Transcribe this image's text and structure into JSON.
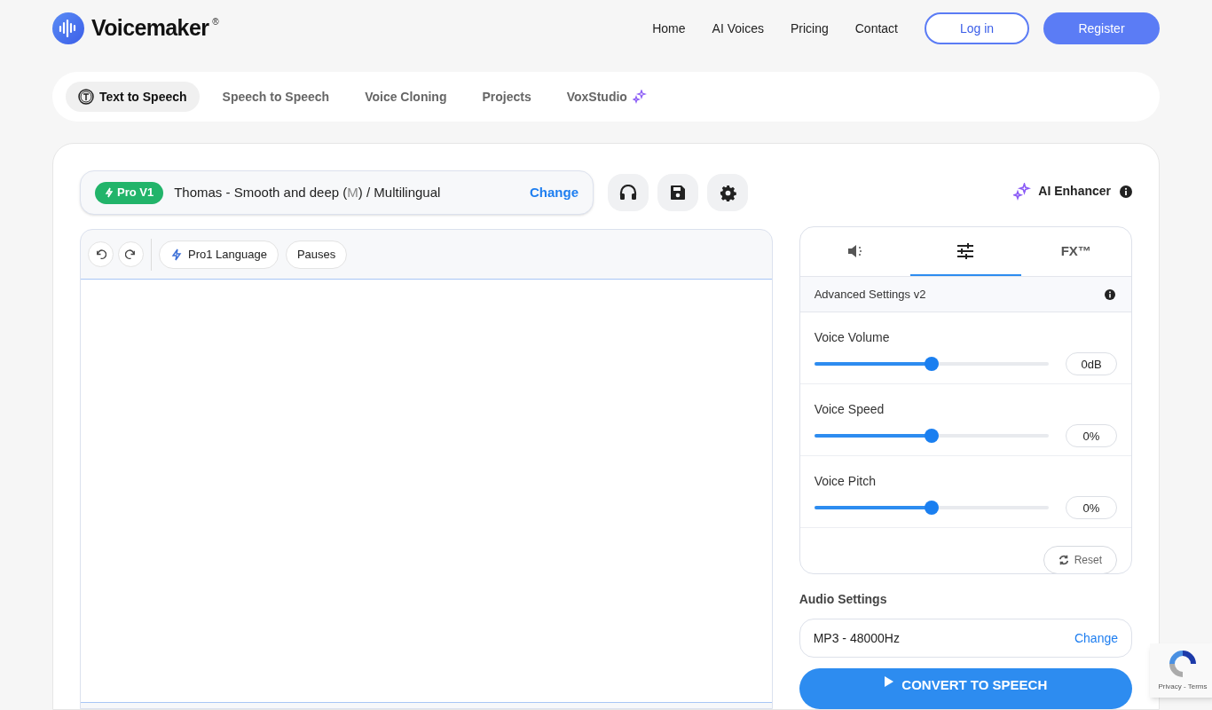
{
  "header": {
    "brand": "Voicemaker",
    "brand_mark": "®",
    "nav": [
      "Home",
      "AI Voices",
      "Pricing",
      "Contact"
    ],
    "login": "Log in",
    "register": "Register"
  },
  "tabs": [
    {
      "label": "Text to Speech",
      "selected": true
    },
    {
      "label": "Speech to Speech",
      "selected": false
    },
    {
      "label": "Voice Cloning",
      "selected": false
    },
    {
      "label": "Projects",
      "selected": false
    },
    {
      "label": "VoxStudio",
      "selected": false
    }
  ],
  "voice": {
    "badge": "Pro V1",
    "name": "Thomas - Smooth and deep (",
    "gender": "M",
    "rest": ") / Multilingual",
    "change": "Change"
  },
  "ai_enhancer": "AI Enhancer",
  "editor": {
    "chips": [
      {
        "label": "Pro1 Language"
      },
      {
        "label": "Pauses"
      }
    ]
  },
  "panel": {
    "tabs": [
      {
        "kind": "icon",
        "selected": false
      },
      {
        "kind": "icon",
        "selected": true
      },
      {
        "kind": "text",
        "label": "FX™",
        "selected": false
      }
    ],
    "header": "Advanced Settings v2",
    "sliders": [
      {
        "label": "Voice Volume",
        "level": 0.5,
        "reading": "0dB"
      },
      {
        "label": "Voice Speed",
        "level": 0.5,
        "reading": "0%"
      },
      {
        "label": "Voice Pitch",
        "level": 0.5,
        "reading": "0%"
      }
    ],
    "reset": "Reset"
  },
  "audio": {
    "title": "Audio Settings",
    "format": "MP3 - 48000Hz",
    "change": "Change"
  },
  "convert": "CONVERT TO SPEECH",
  "recaptcha": "Privacy - Terms"
}
